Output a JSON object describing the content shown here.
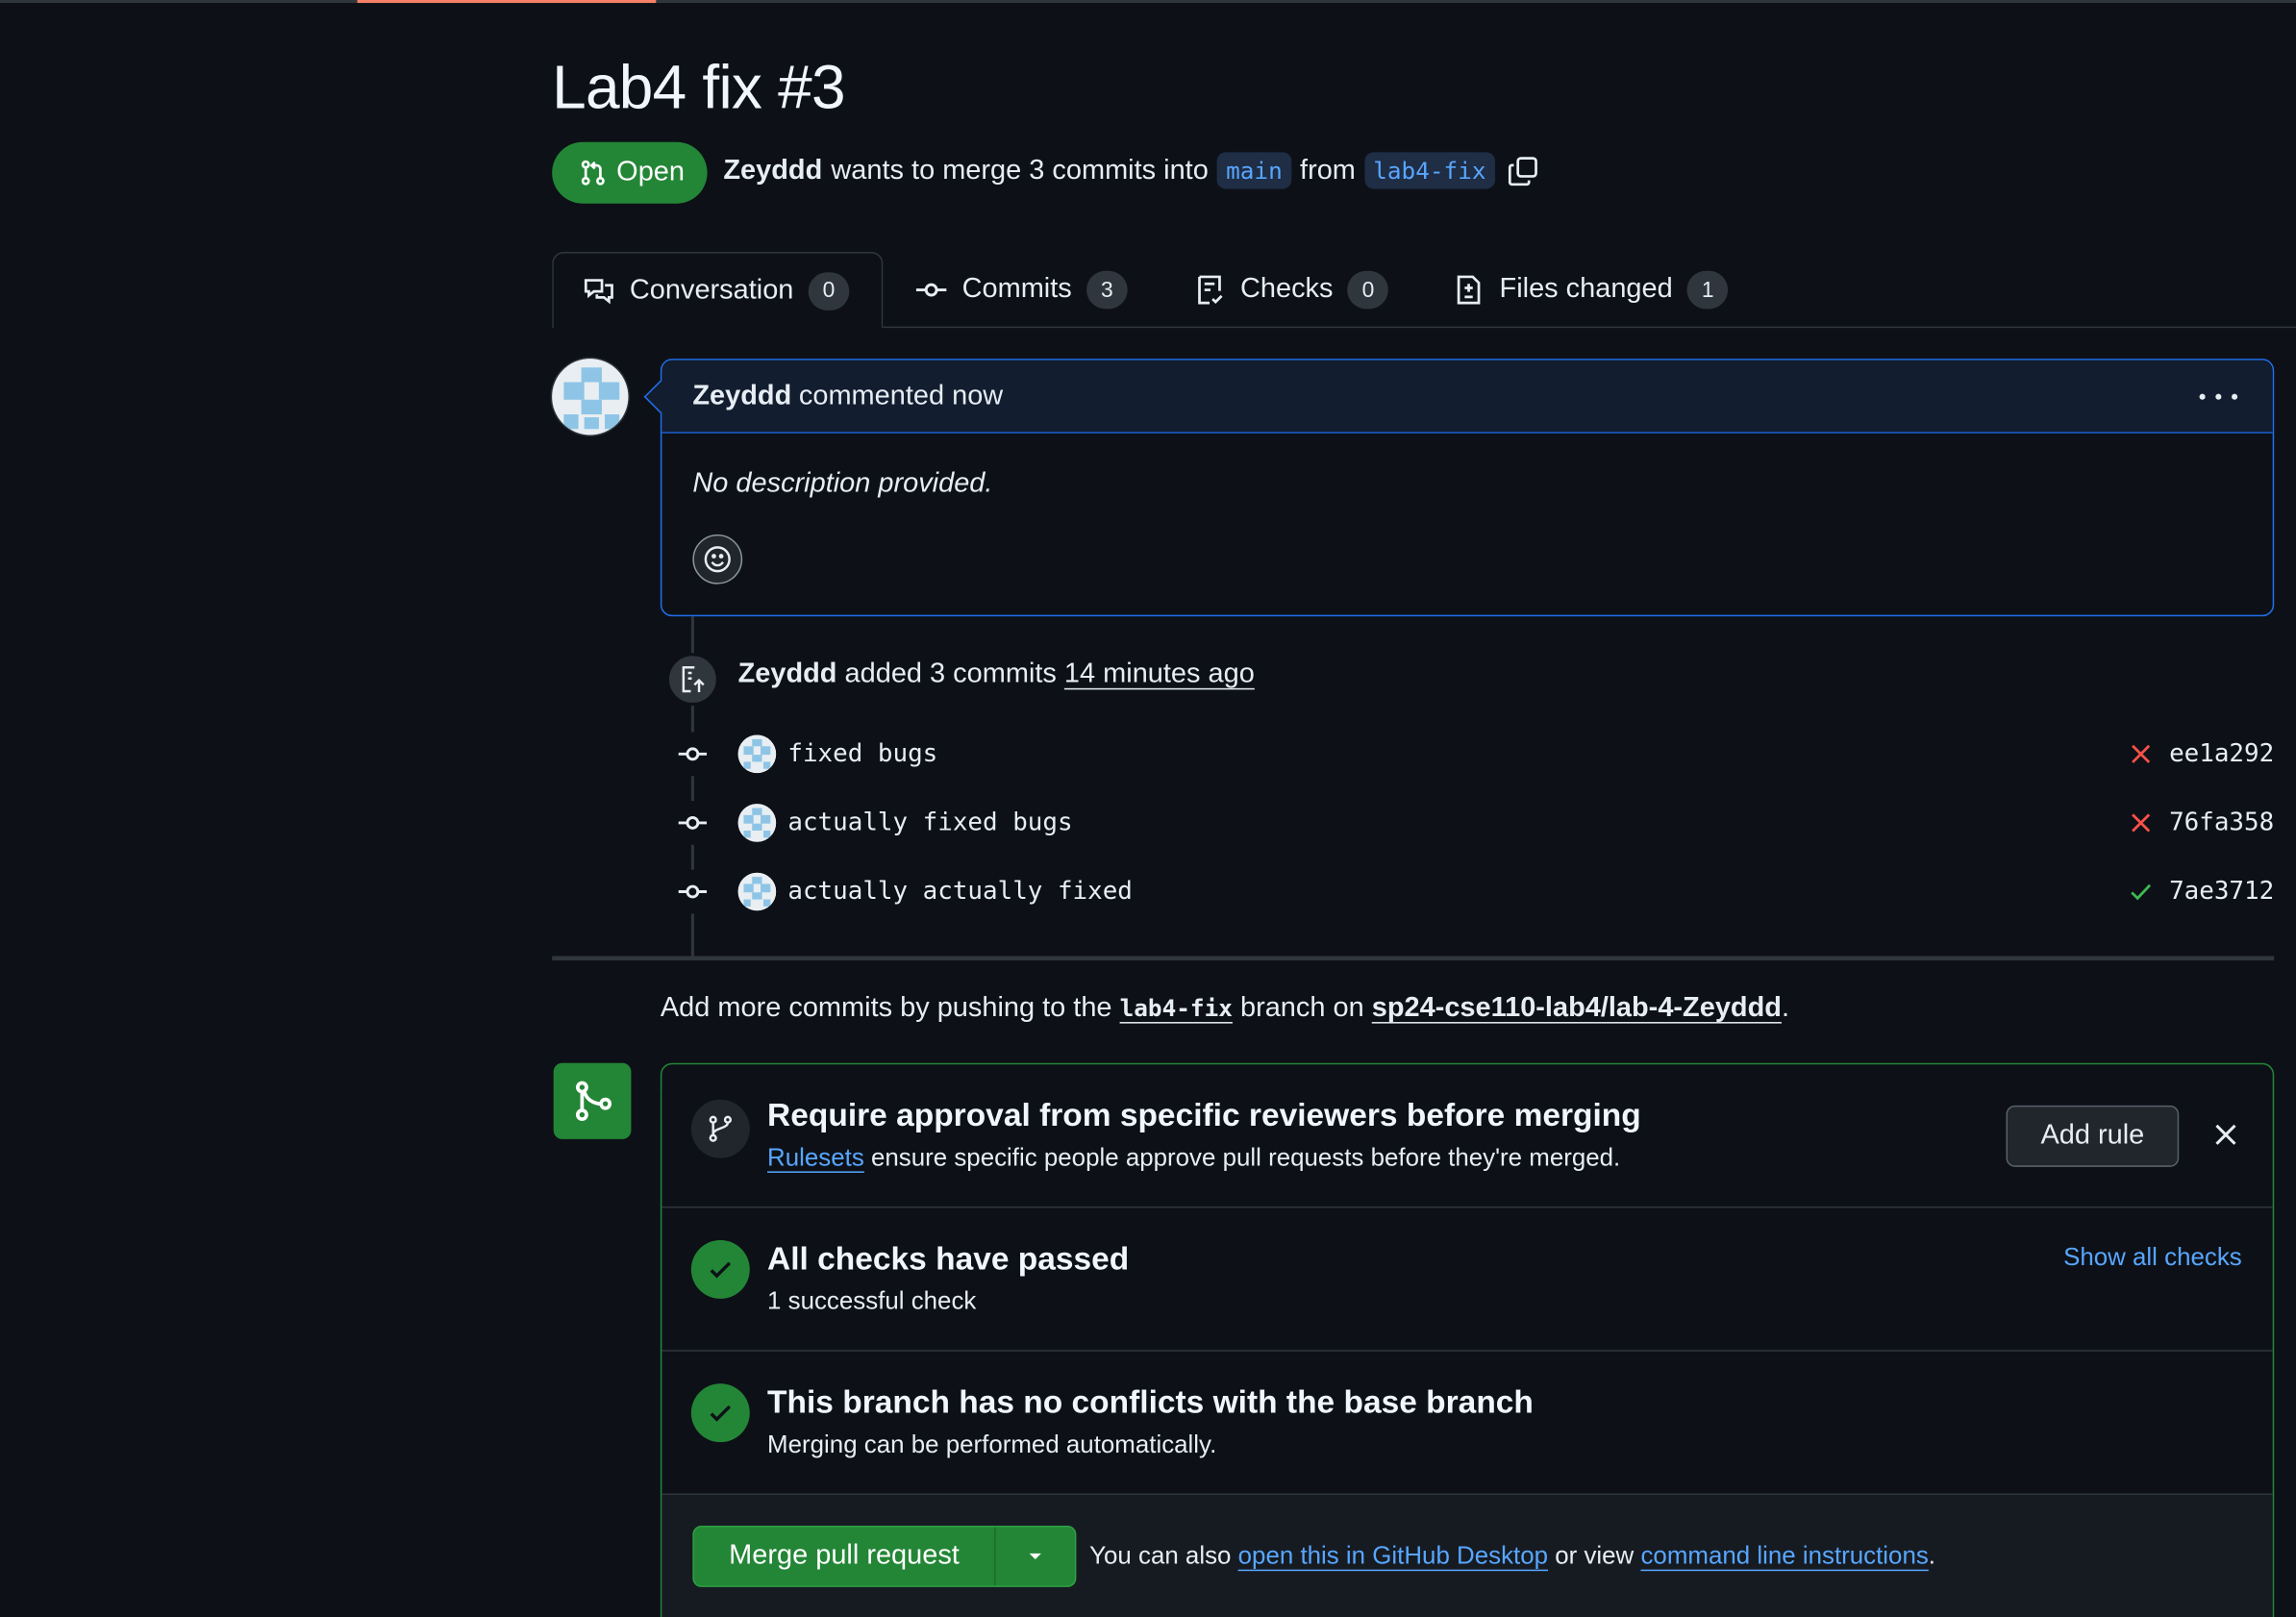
{
  "title": "Lab4 fix #3",
  "state": {
    "label": "Open",
    "color": "#238636"
  },
  "meta": {
    "author": "Zeyddd",
    "text1": "wants to merge 3 commits into",
    "base_branch": "main",
    "text2": "from",
    "head_branch": "lab4-fix"
  },
  "tabs": [
    {
      "label": "Conversation",
      "count": "0",
      "icon": "comment-discussion-icon"
    },
    {
      "label": "Commits",
      "count": "3",
      "icon": "git-commit-icon"
    },
    {
      "label": "Checks",
      "count": "0",
      "icon": "checklist-icon"
    },
    {
      "label": "Files changed",
      "count": "1",
      "icon": "file-diff-icon"
    }
  ],
  "comment": {
    "author": "Zeyddd",
    "action": "commented now",
    "body": "No description provided."
  },
  "push_event": {
    "author": "Zeyddd",
    "action": "added 3 commits",
    "time": "14 minutes ago"
  },
  "commits": [
    {
      "message": "fixed bugs",
      "sha": "ee1a292",
      "status": "failure"
    },
    {
      "message": "actually fixed bugs",
      "sha": "76fa358",
      "status": "failure"
    },
    {
      "message": "actually actually fixed",
      "sha": "7ae3712",
      "status": "success"
    }
  ],
  "add_more": {
    "prefix": "Add more commits by pushing to the",
    "branch": "lab4-fix",
    "middle": "branch on",
    "repo": "sp24-cse110-lab4/lab-4-Zeyddd",
    "suffix": "."
  },
  "merge_box": {
    "ruleset": {
      "title": "Require approval from specific reviewers before merging",
      "link": "Rulesets",
      "text": "ensure specific people approve pull requests before they're merged.",
      "button": "Add rule"
    },
    "checks": {
      "title": "All checks have passed",
      "sub": "1 successful check",
      "link": "Show all checks"
    },
    "conflicts": {
      "title": "This branch has no conflicts with the base branch",
      "sub": "Merging can be performed automatically."
    },
    "merge_button": "Merge pull request",
    "note_prefix": "You can also",
    "note_link1": "open this in GitHub Desktop",
    "note_middle": "or view",
    "note_link2": "command line instructions",
    "note_suffix": "."
  },
  "colors": {
    "accent_green": "#238636",
    "link_blue": "#58a6ff",
    "failure_red": "#f85149",
    "success_green": "#3fb950"
  }
}
